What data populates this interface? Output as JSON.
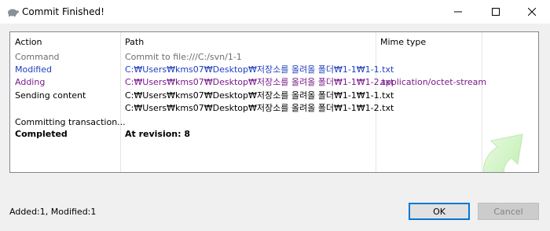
{
  "window": {
    "title": "Commit Finished!"
  },
  "columns": {
    "action": "Action",
    "path": "Path",
    "mime": "Mime type"
  },
  "rows": [
    {
      "action": "Command",
      "path": "Commit to file:///C:/svn/1-1",
      "mime": "",
      "color": "#6d6d6d",
      "bold": false
    },
    {
      "action": "Modified",
      "path": "C:₩Users₩kms07₩Desktop₩저장소를 올려올 폴더₩1-1₩1-1.txt",
      "mime": "",
      "color": "#1f3fbf",
      "bold": false
    },
    {
      "action": "Adding",
      "path": "C:₩Users₩kms07₩Desktop₩저장소를 올려올 폴더₩1-1₩1-2.txt",
      "mime": "application/octet-stream",
      "color": "#7a1a8a",
      "bold": false
    },
    {
      "action": "Sending content",
      "path": "C:₩Users₩kms07₩Desktop₩저장소를 올려올 폴더₩1-1₩1-1.txt",
      "mime": "",
      "color": "#000000",
      "bold": false
    },
    {
      "action": "",
      "path": "C:₩Users₩kms07₩Desktop₩저장소를 올려올 폴더₩1-1₩1-2.txt",
      "mime": "",
      "color": "#000000",
      "bold": false
    },
    {
      "action": "Committing transaction...",
      "path": "",
      "mime": "",
      "color": "#000000",
      "bold": false
    },
    {
      "action": "Completed",
      "path": "At revision: 8",
      "mime": "",
      "color": "#000000",
      "bold": true
    }
  ],
  "status": {
    "text": "Added:1, Modified:1"
  },
  "buttons": {
    "ok": "OK",
    "cancel": "Cancel"
  },
  "icons": {
    "app": "tortoise-icon",
    "minimize": "minimize-icon",
    "maximize": "maximize-icon",
    "close": "close-icon",
    "decor": "green-arrow-icon"
  }
}
